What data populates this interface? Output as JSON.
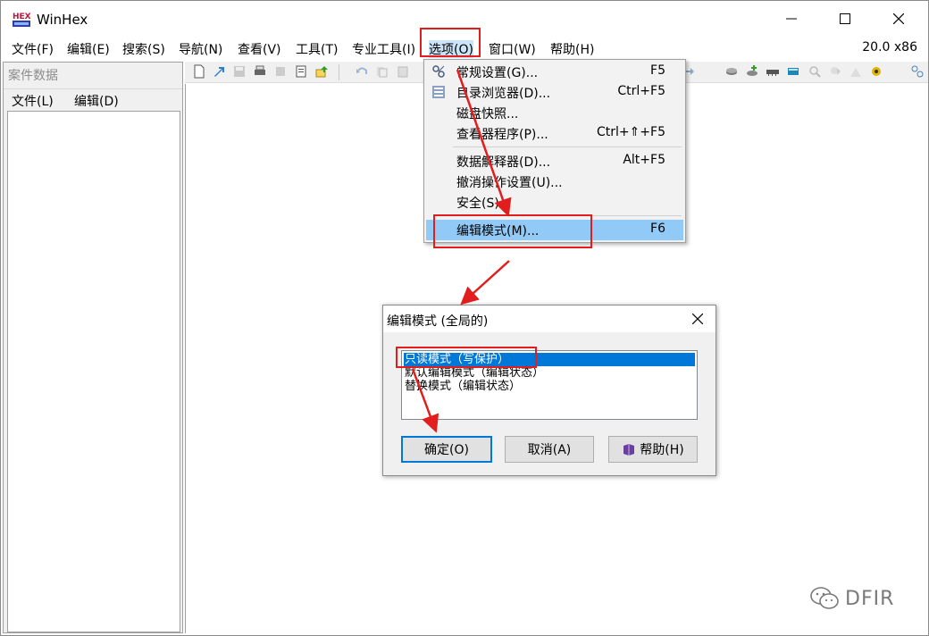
{
  "window": {
    "title": "WinHex",
    "version": "20.0 x86"
  },
  "menubar": {
    "items": [
      "文件(F)",
      "编辑(E)",
      "搜索(S)",
      "导航(N)",
      "查看(V)",
      "工具(T)",
      "专业工具(I)",
      "选项(O)",
      "窗口(W)",
      "帮助(H)"
    ],
    "active_index": 7
  },
  "left_pane": {
    "header": "案件数据",
    "menu": [
      "文件(L)",
      "编辑(D)"
    ]
  },
  "options_menu": {
    "items": [
      {
        "label": "常规设置(G)...",
        "shortcut": "F5",
        "icon": "settings-icon"
      },
      {
        "label": "目录浏览器(D)...",
        "shortcut": "Ctrl+F5",
        "icon": "directory-browser-icon"
      },
      {
        "label": "磁盘快照...",
        "shortcut": ""
      },
      {
        "label": "查看器程序(P)...",
        "shortcut": "Ctrl+⇑+F5"
      },
      {
        "label": "数据解释器(D)...",
        "shortcut": "Alt+F5"
      },
      {
        "label": "撤消操作设置(U)...",
        "shortcut": ""
      },
      {
        "label": "安全(S)...",
        "shortcut": ""
      },
      {
        "label": "编辑模式(M)...",
        "shortcut": "F6"
      }
    ],
    "highlighted_index": 7
  },
  "dialog": {
    "title": "编辑模式 (全局的)",
    "options": [
      "只读模式（写保护）",
      "默认编辑模式（编辑状态）",
      "替换模式（编辑状态）"
    ],
    "selected_index": 0,
    "buttons": {
      "ok": "确定(O)",
      "cancel": "取消(A)",
      "help": "帮助(H)"
    }
  },
  "watermark": {
    "text": "DFIR"
  },
  "colors": {
    "annotation": "#e11d1d",
    "menu_highlight": "#91c9f7",
    "selection": "#0078d7"
  }
}
